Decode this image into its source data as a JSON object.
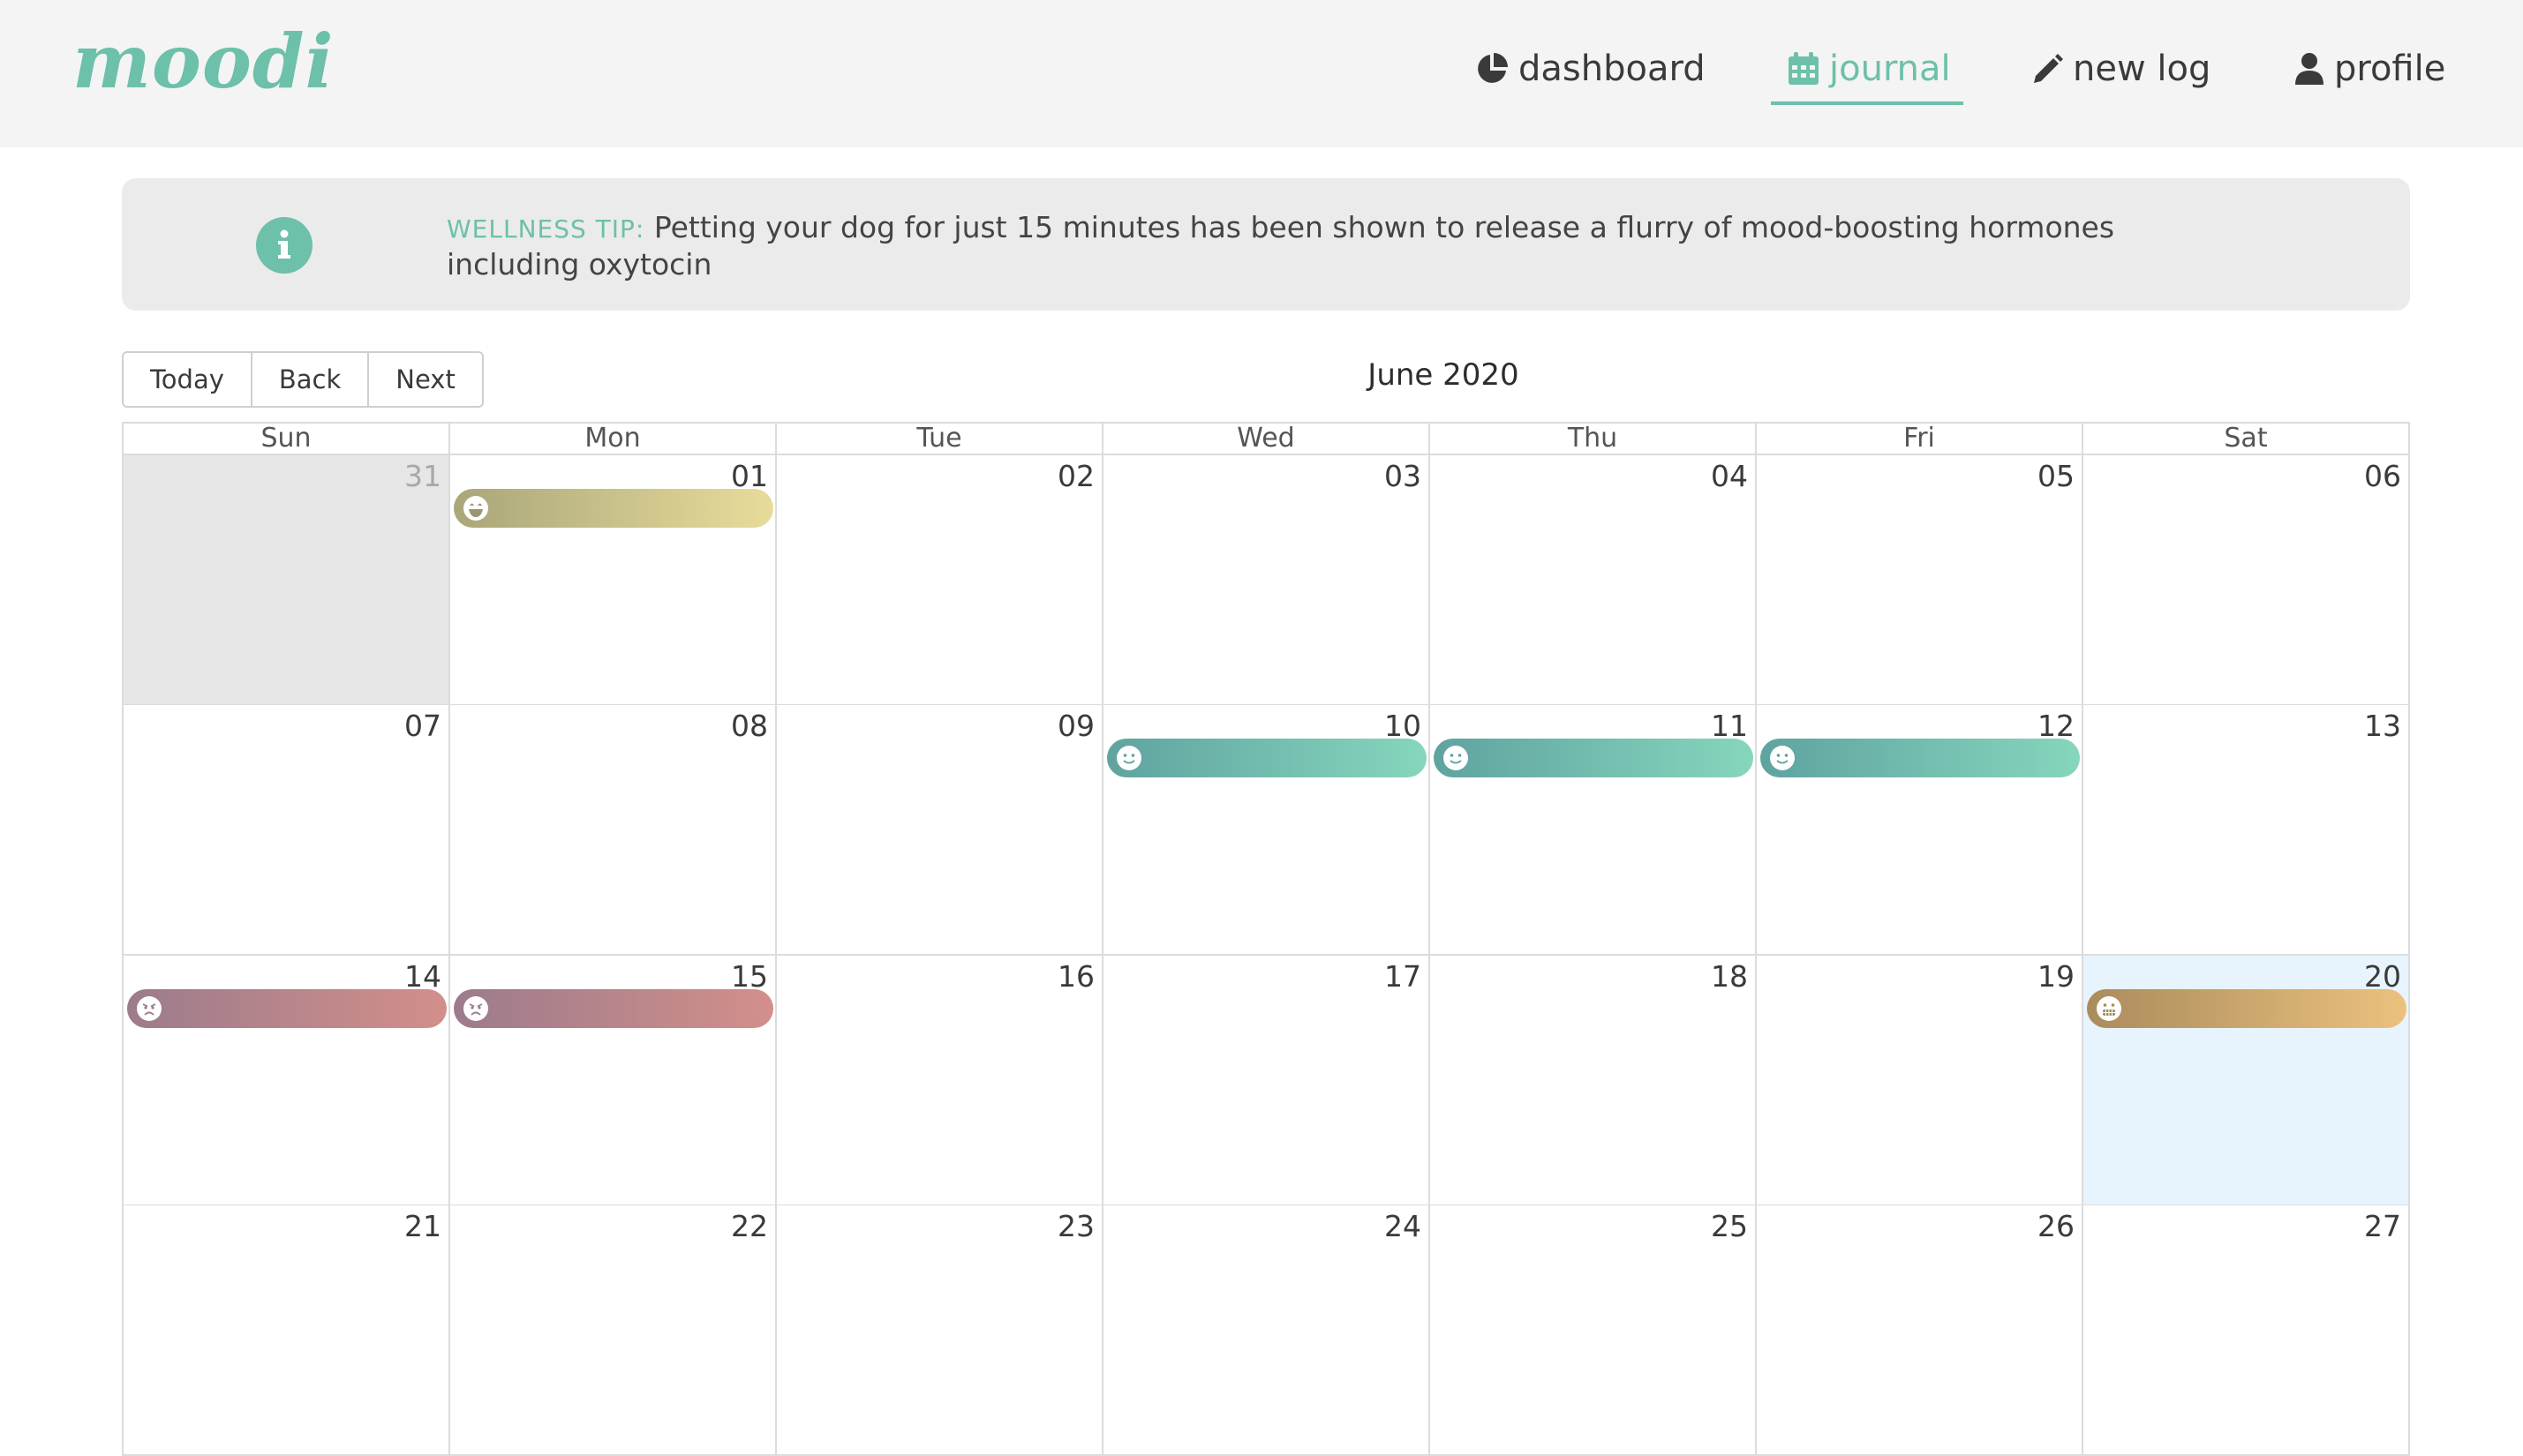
{
  "app": {
    "logo": "moodi"
  },
  "nav": {
    "items": [
      {
        "label": "dashboard",
        "icon": "pie-chart-icon"
      },
      {
        "label": "journal",
        "icon": "calendar-icon",
        "active": true
      },
      {
        "label": "new log",
        "icon": "pencil-icon"
      },
      {
        "label": "profile",
        "icon": "user-icon"
      }
    ]
  },
  "tip": {
    "label": "WELLNESS TIP",
    "colon": ":",
    "text": "Petting your dog for just 15 minutes has been shown to release a flurry of mood-boosting hormones including oxytocin",
    "icon": "info-icon"
  },
  "toolbar": {
    "today": "Today",
    "back": "Back",
    "next": "Next",
    "title": "June 2020"
  },
  "calendar": {
    "days_of_week": [
      "Sun",
      "Mon",
      "Tue",
      "Wed",
      "Thu",
      "Fri",
      "Sat"
    ],
    "weeks": [
      [
        "31",
        "01",
        "02",
        "03",
        "04",
        "05",
        "06"
      ],
      [
        "07",
        "08",
        "09",
        "10",
        "11",
        "12",
        "13"
      ],
      [
        "14",
        "15",
        "16",
        "17",
        "18",
        "19",
        "20"
      ],
      [
        "21",
        "22",
        "23",
        "24",
        "25",
        "26",
        "27"
      ]
    ],
    "out_of_month": [
      "31"
    ],
    "today": "20",
    "events": [
      {
        "day": "01",
        "mood": "laughing",
        "icon": "laughing-face-icon",
        "from": "#a9a67a",
        "to": "#e8dc9a"
      },
      {
        "day": "10",
        "mood": "happy",
        "icon": "smile-face-icon",
        "from": "#5fa3a0",
        "to": "#86d6bd"
      },
      {
        "day": "11",
        "mood": "happy",
        "icon": "smile-face-icon",
        "from": "#5fa3a0",
        "to": "#86d6bd"
      },
      {
        "day": "12",
        "mood": "happy",
        "icon": "smile-face-icon",
        "from": "#5fa3a0",
        "to": "#86d6bd"
      },
      {
        "day": "14",
        "mood": "angry",
        "icon": "angry-face-icon",
        "from": "#9c7b8c",
        "to": "#d38f8a"
      },
      {
        "day": "15",
        "mood": "angry",
        "icon": "angry-face-icon",
        "from": "#9c7b8c",
        "to": "#d38f8a"
      },
      {
        "day": "20",
        "mood": "grimacing",
        "icon": "grimace-face-icon",
        "from": "#aa8c5c",
        "to": "#ecc17e"
      }
    ]
  },
  "colors": {
    "accent": "#6dc0a9",
    "today_bg": "#e8f4fd",
    "off_bg": "#e6e6e6"
  }
}
